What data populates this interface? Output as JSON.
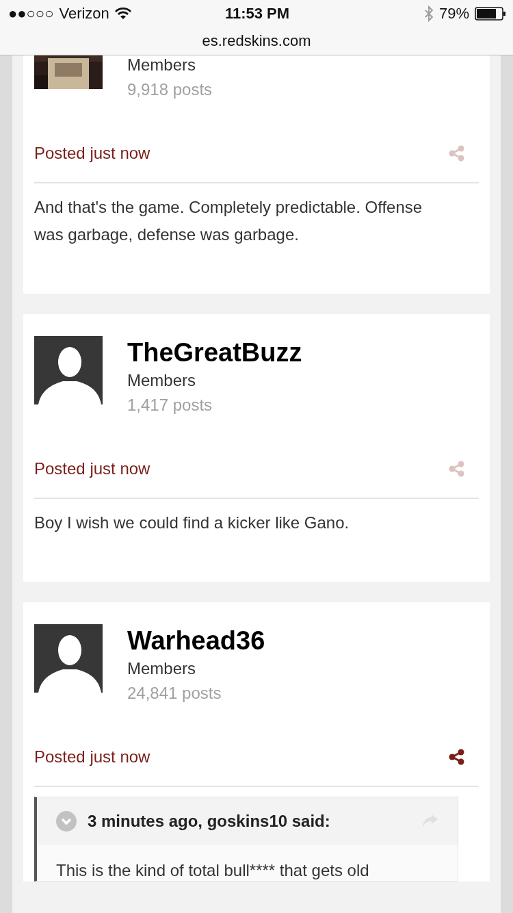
{
  "status_bar": {
    "signal_bars": "●●○○○",
    "carrier": "Verizon",
    "time": "11:53 PM",
    "battery": "79%"
  },
  "url": "es.redskins.com",
  "posts": [
    {
      "role": "Members",
      "post_count": "9,918 posts",
      "posted": "Posted just now",
      "share_active": false,
      "body": "And that's the game. Completely predictable. Offense was garbage, defense was garbage."
    },
    {
      "username": "TheGreatBuzz",
      "role": "Members",
      "post_count": "1,417 posts",
      "posted": "Posted just now",
      "share_active": false,
      "body": "Boy I wish we could find a kicker like Gano."
    },
    {
      "username": "Warhead36",
      "role": "Members",
      "post_count": "24,841 posts",
      "posted": "Posted just now",
      "share_active": true,
      "quote": {
        "header": "3 minutes ago, goskins10 said:",
        "text": "This is the kind of total bull**** that gets old"
      }
    }
  ]
}
